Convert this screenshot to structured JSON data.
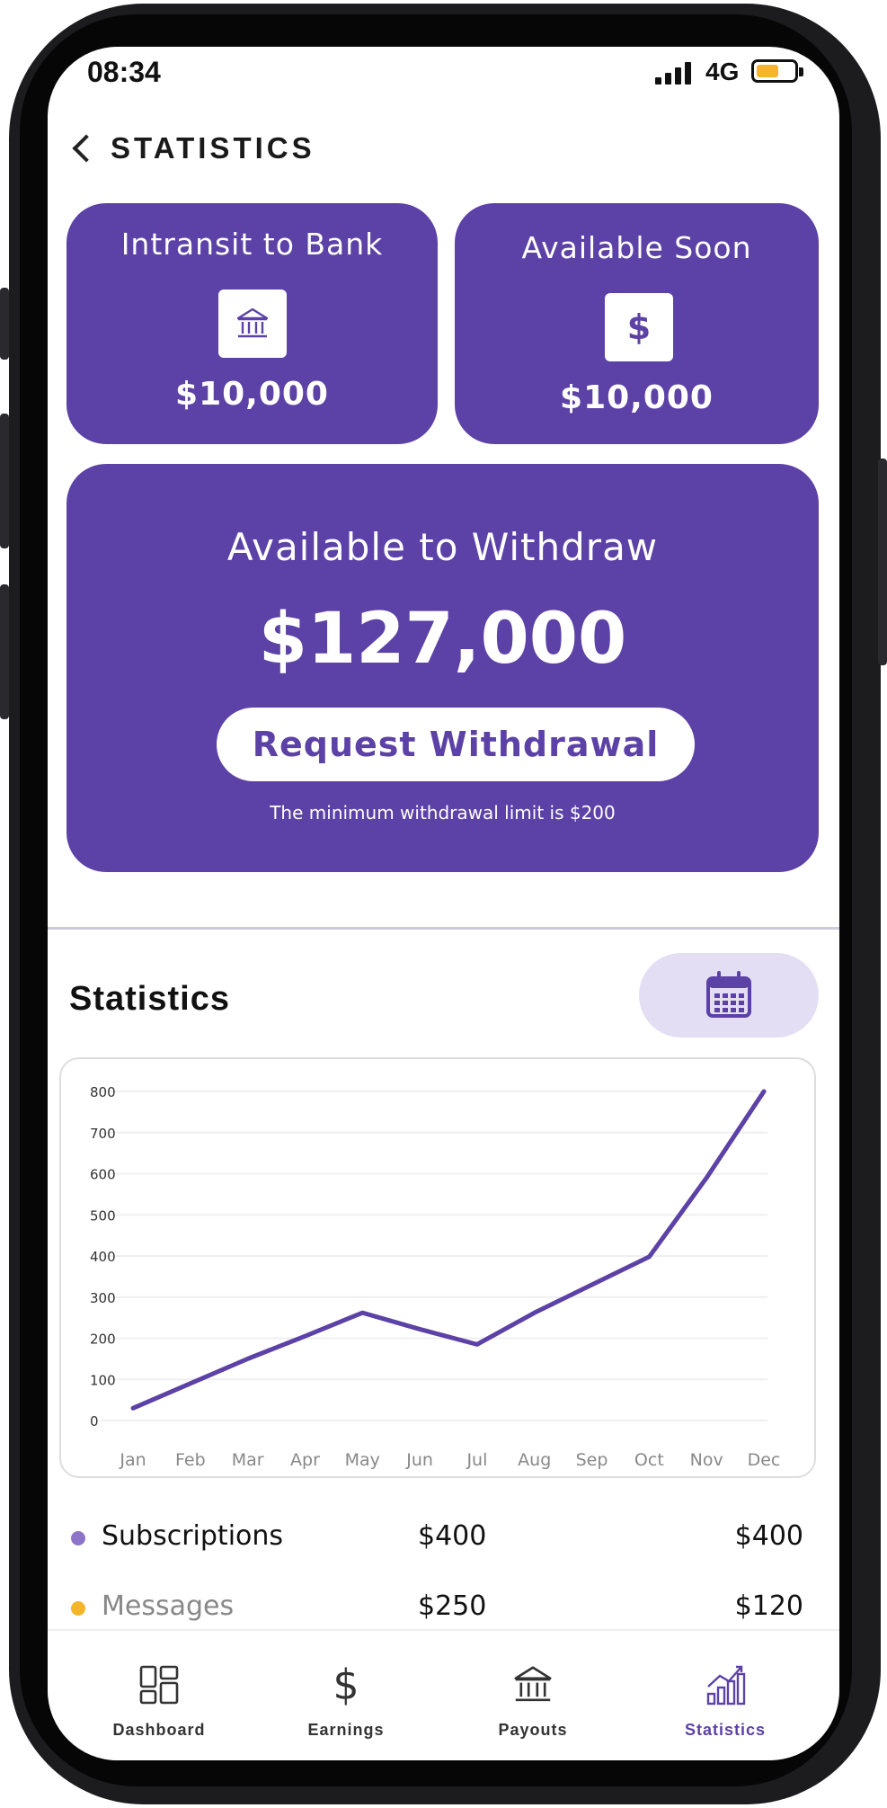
{
  "status_bar": {
    "time": "08:34",
    "network": "4G"
  },
  "header": {
    "title": "STATISTICS"
  },
  "cards": {
    "intransit": {
      "title": "Intransit to Bank",
      "amount": "$10,000",
      "icon": "bank-icon"
    },
    "available_soon": {
      "title": "Available Soon",
      "amount": "$10,000",
      "icon": "dollar-icon",
      "icon_glyph": "$"
    },
    "withdraw": {
      "title": "Available to Withdraw",
      "amount": "$127,000",
      "button_label": "Request Withdrawal",
      "note": "The minimum withdrawal limit is $200"
    }
  },
  "statistics": {
    "heading": "Statistics",
    "calendar_icon": "calendar-icon"
  },
  "colors": {
    "accent": "#5c41a6",
    "accent_light": "#e3def3",
    "line": "#5c41a6",
    "subscriptions_dot": "#8d74c9",
    "messages_dot": "#f5b52a"
  },
  "chart_data": {
    "type": "line",
    "categories": [
      "Jan",
      "Feb",
      "Mar",
      "Apr",
      "May",
      "Jun",
      "Jul",
      "Aug",
      "Sep",
      "Oct",
      "Nov",
      "Dec"
    ],
    "y_ticks": [
      "800",
      "700",
      "600",
      "500",
      "400",
      "300",
      "200",
      "100",
      "0"
    ],
    "ylim": [
      0,
      800
    ],
    "grid": true,
    "series": [
      {
        "values": [
          30,
          90,
          150,
          205,
          262,
          222,
          185,
          262,
          330,
          398,
          590,
          800
        ]
      }
    ]
  },
  "legend": [
    {
      "label": "Subscriptions",
      "value1": "$400",
      "value2": "$400",
      "color": "#8d74c9"
    },
    {
      "label": "Messages",
      "value1": "$250",
      "value2": "$120",
      "color": "#f5b52a"
    }
  ],
  "nav": [
    {
      "label": "Dashboard",
      "icon": "dashboard-icon"
    },
    {
      "label": "Earnings",
      "icon": "dollar-icon",
      "glyph": "$"
    },
    {
      "label": "Payouts",
      "icon": "bank-icon"
    },
    {
      "label": "Statistics",
      "icon": "chart-icon"
    }
  ]
}
